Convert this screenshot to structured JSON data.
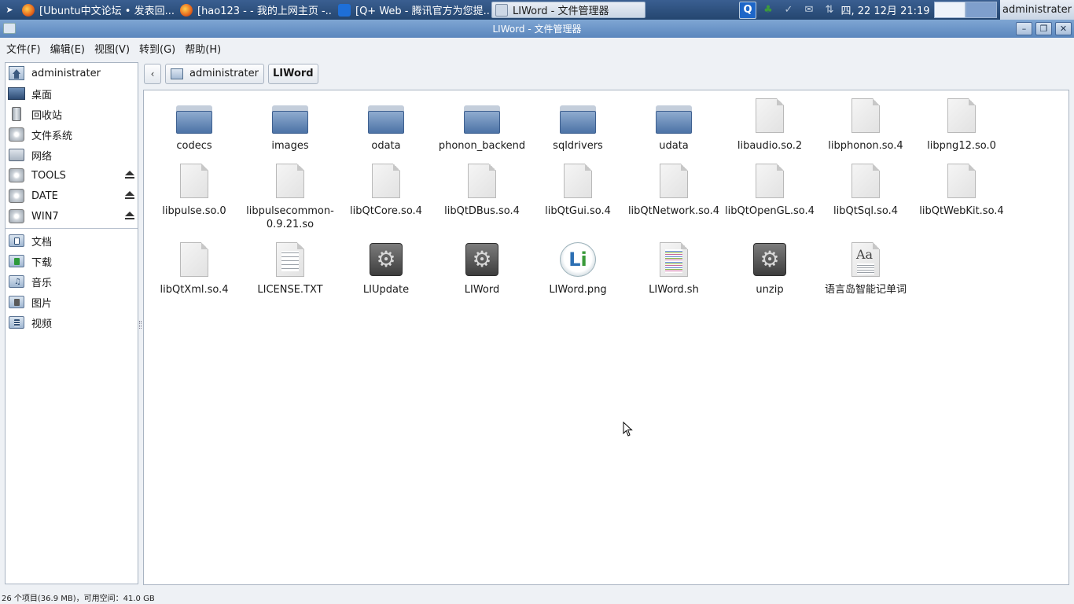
{
  "taskbar": {
    "tasks": [
      {
        "label": "[Ubuntu中文论坛 • 发表回...",
        "icon": "firefox-icon"
      },
      {
        "label": "[hao123 -  - 我的上网主页 -...",
        "icon": "firefox-icon"
      },
      {
        "label": "[Q+ Web - 腾讯官方为您提...",
        "icon": "qq-icon"
      },
      {
        "label": "LIWord - 文件管理器",
        "icon": "file-manager-icon",
        "active": true
      }
    ],
    "clock": "四, 22 12月  21:19",
    "user": "administrater"
  },
  "window": {
    "title": "LIWord - 文件管理器"
  },
  "menubar": [
    "文件(F)",
    "编辑(E)",
    "视图(V)",
    "转到(G)",
    "帮助(H)"
  ],
  "sidebar": {
    "places": [
      {
        "label": "administrater",
        "icon": "home-icon"
      },
      {
        "label": "桌面",
        "icon": "desktop-icon"
      },
      {
        "label": "回收站",
        "icon": "trash-icon"
      },
      {
        "label": "文件系统",
        "icon": "filesystem-icon"
      },
      {
        "label": "网络",
        "icon": "network-icon"
      },
      {
        "label": "TOOLS",
        "icon": "drive-icon",
        "eject": true
      },
      {
        "label": "DATE",
        "icon": "drive-icon",
        "eject": true
      },
      {
        "label": "WIN7",
        "icon": "drive-icon",
        "eject": true
      }
    ],
    "bookmarks": [
      {
        "label": "文档",
        "icon": "documents-folder-icon"
      },
      {
        "label": "下载",
        "icon": "downloads-folder-icon"
      },
      {
        "label": "音乐",
        "icon": "music-folder-icon"
      },
      {
        "label": "图片",
        "icon": "pictures-folder-icon"
      },
      {
        "label": "视频",
        "icon": "videos-folder-icon"
      }
    ]
  },
  "pathbar": {
    "home": "administrater",
    "current": "LIWord"
  },
  "files": [
    {
      "name": "codecs",
      "type": "folder"
    },
    {
      "name": "images",
      "type": "folder"
    },
    {
      "name": "odata",
      "type": "folder"
    },
    {
      "name": "phonon_backend",
      "type": "folder"
    },
    {
      "name": "sqldrivers",
      "type": "folder"
    },
    {
      "name": "udata",
      "type": "folder"
    },
    {
      "name": "libaudio.so.2",
      "type": "file"
    },
    {
      "name": "libphonon.so.4",
      "type": "file"
    },
    {
      "name": "libpng12.so.0",
      "type": "file"
    },
    {
      "name": "libpulse.so.0",
      "type": "file"
    },
    {
      "name": "libpulsecommon-0.9.21.so",
      "type": "file"
    },
    {
      "name": "libQtCore.so.4",
      "type": "file"
    },
    {
      "name": "libQtDBus.so.4",
      "type": "file"
    },
    {
      "name": "libQtGui.so.4",
      "type": "file"
    },
    {
      "name": "libQtNetwork.so.4",
      "type": "file"
    },
    {
      "name": "libQtOpenGL.so.4",
      "type": "file"
    },
    {
      "name": "libQtSql.so.4",
      "type": "file"
    },
    {
      "name": "libQtWebKit.so.4",
      "type": "file"
    },
    {
      "name": "libQtXml.so.4",
      "type": "file"
    },
    {
      "name": "LICENSE.TXT",
      "type": "text"
    },
    {
      "name": "LIUpdate",
      "type": "executable"
    },
    {
      "name": "LIWord",
      "type": "executable"
    },
    {
      "name": "LIWord.png",
      "type": "image"
    },
    {
      "name": "LIWord.sh",
      "type": "script"
    },
    {
      "name": "unzip",
      "type": "executable"
    },
    {
      "name": "语言岛智能记单词",
      "type": "desktop"
    }
  ],
  "statusbar": "26 个项目(36.9 MB)，可用空间：41.0 GB"
}
